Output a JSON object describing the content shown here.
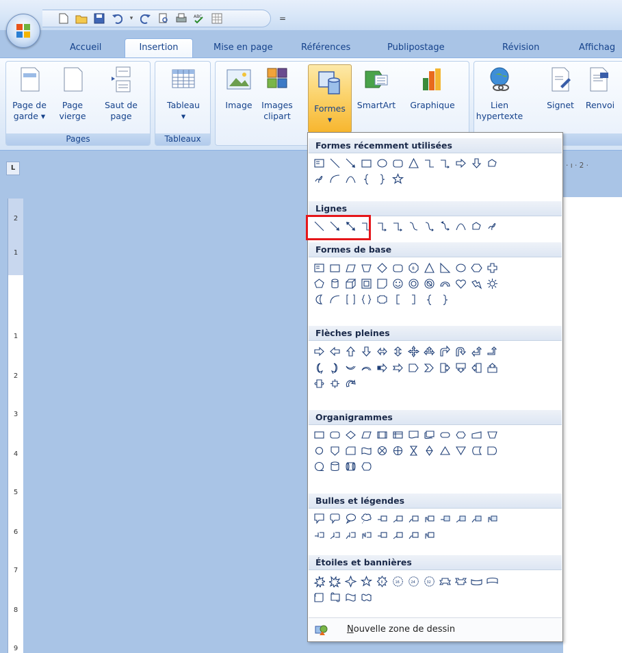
{
  "qat": {
    "more": "="
  },
  "tabs": [
    {
      "label": "Accueil"
    },
    {
      "label": "Insertion"
    },
    {
      "label": "Mise en page"
    },
    {
      "label": "Références"
    },
    {
      "label": "Publipostage"
    },
    {
      "label": "Révision"
    },
    {
      "label": "Affichag"
    }
  ],
  "ribbon": {
    "pages": {
      "label": "Pages",
      "buttons": [
        {
          "line1": "Page de",
          "line2": "garde ▾"
        },
        {
          "line1": "Page",
          "line2": "vierge"
        },
        {
          "line1": "Saut de",
          "line2": "page"
        }
      ]
    },
    "tableaux": {
      "label": "Tableaux",
      "button": {
        "line1": "Tableau",
        "line2": "▾"
      }
    },
    "illustrations": {
      "buttons": [
        {
          "line1": "Image",
          "line2": ""
        },
        {
          "line1": "Images",
          "line2": "clipart"
        },
        {
          "line1": "Formes",
          "line2": "▾"
        },
        {
          "line1": "SmartArt",
          "line2": ""
        },
        {
          "line1": "Graphique",
          "line2": ""
        }
      ]
    },
    "liens": {
      "label": "s",
      "buttons": [
        {
          "line1": "Lien",
          "line2": "hypertexte"
        },
        {
          "line1": "Signet",
          "line2": ""
        },
        {
          "line1": "Renvoi",
          "line2": ""
        }
      ]
    }
  },
  "ruler": {
    "corner": "L",
    "h_text": "1 · ı · 2 ·",
    "v_numbers": [
      "2",
      "1",
      "1",
      "2",
      "3",
      "4",
      "5",
      "6",
      "7",
      "8",
      "9"
    ]
  },
  "menu": {
    "sections": [
      {
        "title": "Formes récemment utilisées"
      },
      {
        "title": "Lignes"
      },
      {
        "title": "Formes de base"
      },
      {
        "title": "Flèches pleines"
      },
      {
        "title": "Organigrammes"
      },
      {
        "title": "Bulles et légendes"
      },
      {
        "title": "Étoiles et bannières"
      }
    ],
    "footer": {
      "accel": "N",
      "rest": "ouvelle zone de dessin"
    }
  },
  "colors": {
    "highlight": "#e5161a",
    "ribbon_selected": "#fbd36c"
  }
}
